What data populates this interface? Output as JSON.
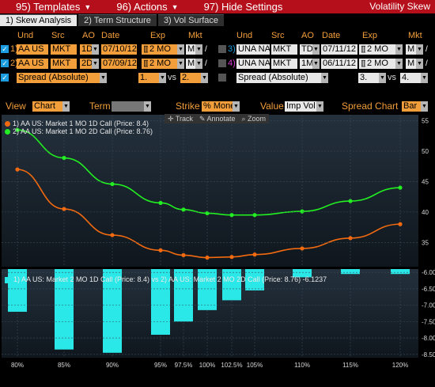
{
  "topbar": {
    "menus": [
      {
        "label": "95) Templates"
      },
      {
        "label": "96) Actions"
      },
      {
        "label": "97) Hide Settings"
      }
    ],
    "title": "Volatility Skew"
  },
  "tabs": [
    {
      "label": "1) Skew Analysis",
      "active": true
    },
    {
      "label": "2) Term Structure",
      "active": false
    },
    {
      "label": "3) Vol Surface",
      "active": false
    }
  ],
  "left_panel": {
    "headers": {
      "und": "Und",
      "src": "Src",
      "ao": "AO",
      "date": "Date",
      "exp": "Exp",
      "mkt": "Mkt"
    },
    "rows": [
      {
        "num": "1)",
        "und": "AA US",
        "src": "MKT",
        "ao": "1D",
        "date": "07/10/12",
        "exp": "2 MO",
        "mkt": "M"
      },
      {
        "num": "2)",
        "und": "AA US",
        "src": "MKT",
        "ao": "2D",
        "date": "07/09/12",
        "exp": "2 MO",
        "mkt": "M"
      }
    ],
    "spread": {
      "label": "Spread (Absolute)",
      "a": "1.",
      "vs": "vs",
      "b": "2."
    }
  },
  "right_panel": {
    "headers": {
      "und": "Und",
      "src": "Src",
      "ao": "AO",
      "date": "Date",
      "exp": "Exp",
      "mkt": "Mkt"
    },
    "rows": [
      {
        "num": "3)",
        "und": "UNA NA",
        "src": "MKT",
        "ao": "TD",
        "date": "07/11/12",
        "exp": "2 MO",
        "mkt": "M"
      },
      {
        "num": "4)",
        "und": "UNA NA",
        "src": "MKT",
        "ao": "1M",
        "date": "06/11/12",
        "exp": "2 MO",
        "mkt": "M"
      }
    ],
    "spread": {
      "label": "Spread (Absolute)",
      "a": "3.",
      "vs": "vs",
      "b": "4."
    }
  },
  "controls": {
    "view_label": "View",
    "view_value": "Chart",
    "term_label": "Term",
    "term_value": "",
    "strike_label": "Strike",
    "strike_value": "% Money",
    "value_label": "Value",
    "value_value": "Imp Vol",
    "spread_chart_label": "Spread Chart",
    "spread_chart_value": "Bar"
  },
  "chart_toolbar": {
    "track": "Track",
    "annotate": "Annotate",
    "zoom": "Zoom"
  },
  "colors": {
    "series1": "#f26a10",
    "series2": "#22ee22",
    "bar": "#2ae8e8",
    "accent": "#f29e3a",
    "topbar": "#b50f1b"
  },
  "chart_data": [
    {
      "type": "line",
      "x": [
        "80%",
        "85%",
        "90%",
        "95%",
        "97.5%",
        "100%",
        "102.5%",
        "105%",
        "110%",
        "115%",
        "120%"
      ],
      "series": [
        {
          "name": "1) AA US: Market 1 MO 1D Call (Price: 8.4)",
          "values": [
            47.0,
            40.5,
            36.2,
            33.7,
            32.9,
            32.5,
            32.6,
            33.0,
            34.0,
            35.7,
            38.0
          ]
        },
        {
          "name": "2) AA US: Market 1 MO 2D Call (Price: 8.76)",
          "values": [
            53.5,
            48.9,
            44.6,
            41.5,
            40.4,
            39.8,
            39.5,
            39.5,
            40.1,
            41.8,
            44.0
          ]
        }
      ],
      "y_ticks": [
        "55",
        "50",
        "45",
        "40",
        "35"
      ],
      "ylim": [
        31.0,
        56.0
      ],
      "grid": true
    },
    {
      "type": "bar",
      "categories": [
        "80%",
        "85%",
        "90%",
        "95%",
        "97.5%",
        "100%",
        "102.5%",
        "105%",
        "110%",
        "115%",
        "120%"
      ],
      "values": [
        -7.2,
        -8.35,
        -8.45,
        -7.9,
        -7.5,
        -7.15,
        -6.85,
        -6.55,
        -6.15,
        -6.05,
        -6.05
      ],
      "series_label": "1) AA US: Market 2 MO 1D Call (Price: 8.4) vs 2) AA US: Market 2 MO 2D Call (Price: 8.76) -6.1237",
      "y_ticks": [
        "-6.00",
        "-6.50",
        "-7.00",
        "-7.50",
        "-8.00",
        "-8.50"
      ],
      "ylim": [
        -8.6,
        -5.9
      ],
      "grid": true
    }
  ]
}
